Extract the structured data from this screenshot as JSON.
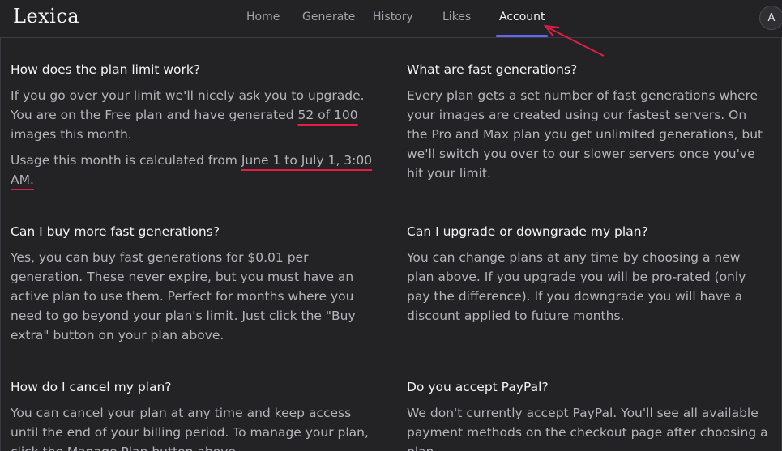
{
  "brand": {
    "name": "Lexica"
  },
  "nav": {
    "items": [
      {
        "label": "Home"
      },
      {
        "label": "Generate"
      },
      {
        "label": "History"
      },
      {
        "label": "Likes"
      },
      {
        "label": "Account",
        "active": true
      }
    ]
  },
  "user": {
    "avatar_initial": "A"
  },
  "faq": [
    {
      "question": "How does the plan limit work?",
      "p1_a": "If you go over your limit we'll nicely ask you to upgrade. You are on the Free plan and have generated ",
      "p1_highlight": "52 of 100",
      "p1_b": " images this month.",
      "p2_a": "Usage this month is calculated from ",
      "p2_highlight": "June 1 to July 1, 3:00 AM."
    },
    {
      "question": "What are fast generations?",
      "answer": "Every plan gets a set number of fast generations where your images are created using our fastest servers. On the Pro and Max plan you get unlimited generations, but we'll switch you over to our slower servers once you've hit your limit."
    },
    {
      "question": "Can I buy more fast generations?",
      "answer": "Yes, you can buy fast generations for $0.01 per generation. These never expire, but you must have an active plan to use them. Perfect for months where you need to go beyond your plan's limit. Just click the \"Buy extra\" button on your plan above."
    },
    {
      "question": "Can I upgrade or downgrade my plan?",
      "answer": "You can change plans at any time by choosing a new plan above. If you upgrade you will be pro-rated (only pay the difference). If you downgrade you will have a discount applied to future months."
    },
    {
      "question": "How do I cancel my plan?",
      "answer": "You can cancel your plan at any time and keep access until the end of your billing period. To manage your plan, click the Manage Plan button above."
    },
    {
      "question": "Do you accept PayPal?",
      "answer": "We don't currently accept PayPal. You'll see all available payment methods on the checkout page after choosing a plan."
    }
  ],
  "colors": {
    "background": "#232326",
    "accent": "#6366f1",
    "annotation": "#e11d48"
  }
}
